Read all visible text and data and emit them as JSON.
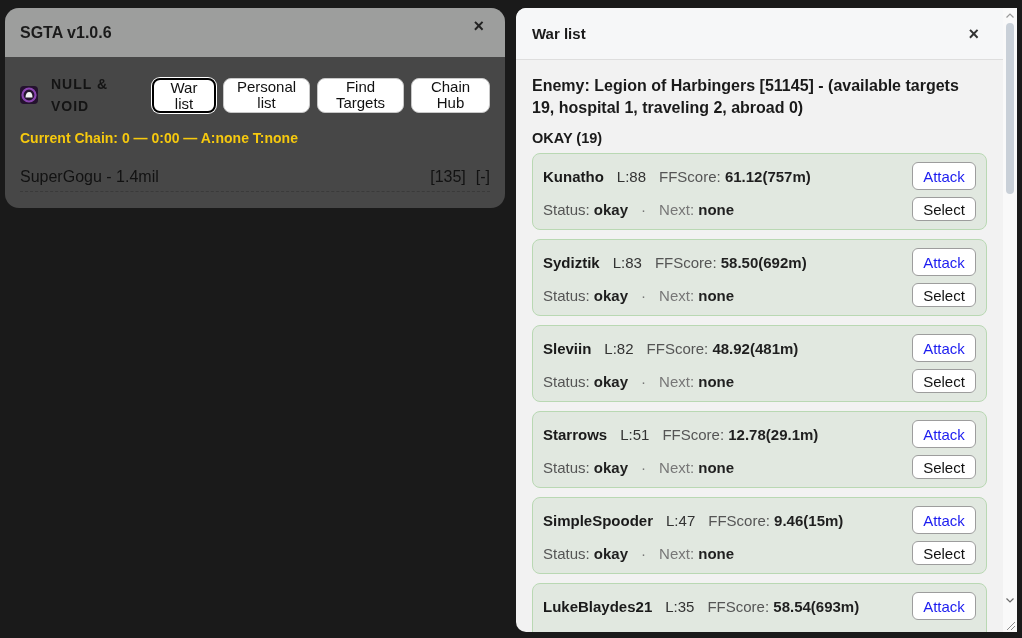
{
  "script_panel": {
    "title": "SGTA v1.0.6",
    "close_label": "×",
    "faction_name": "NULL & VOID",
    "nav_buttons": [
      {
        "label": "War list",
        "selected": true
      },
      {
        "label": "Personal list",
        "selected": false
      },
      {
        "label": "Find Targets",
        "selected": false
      },
      {
        "label": "Chain Hub",
        "selected": false
      }
    ],
    "chain_status": "Current Chain: 0 — 0:00 — A:none T:none",
    "entries": [
      {
        "name": "SuperGogu - 1.4mil",
        "tag": "[135]",
        "toggle": "[-]"
      }
    ]
  },
  "war_list": {
    "title": "War list",
    "close_label": "×",
    "summary": "Enemy: Legion of Harbingers [51145] - (available targets 19, hospital 1, traveling 2, abroad 0)",
    "section": "OKAY (19)",
    "targets": [
      {
        "name": "Kunatho",
        "lvl": "L:88",
        "ffscore": "FFScore: **61.12(757m)**",
        "status": "Status: **okay**",
        "separator": "·",
        "next": "Next: **none**",
        "attack_label": "Attack",
        "select_label": "Select"
      },
      {
        "name": "Sydiztik",
        "lvl": "L:83",
        "ffscore": "FFScore: **58.50(692m)**",
        "status": "Status: **okay**",
        "separator": "·",
        "next": "Next: **none**",
        "attack_label": "Attack",
        "select_label": "Select"
      },
      {
        "name": "Sleviin",
        "lvl": "L:82",
        "ffscore": "FFScore: **48.92(481m)**",
        "status": "Status: **okay**",
        "separator": "·",
        "next": "Next: **none**",
        "attack_label": "Attack",
        "select_label": "Select"
      },
      {
        "name": "Starrows",
        "lvl": "L:51",
        "ffscore": "FFScore: **12.78(29.1m)**",
        "status": "Status: **okay**",
        "separator": "·",
        "next": "Next: **none**",
        "attack_label": "Attack",
        "select_label": "Select"
      },
      {
        "name": "SimpleSpooder",
        "lvl": "L:47",
        "ffscore": "FFScore: **9.46(15m)**",
        "status": "Status: **okay**",
        "separator": "·",
        "next": "Next: **none**",
        "attack_label": "Attack",
        "select_label": "Select"
      },
      {
        "name": "LukeBlaydes21",
        "lvl": "L:35",
        "ffscore": "FFScore: **58.54(693m)**",
        "attack_label": "Attack"
      }
    ]
  }
}
